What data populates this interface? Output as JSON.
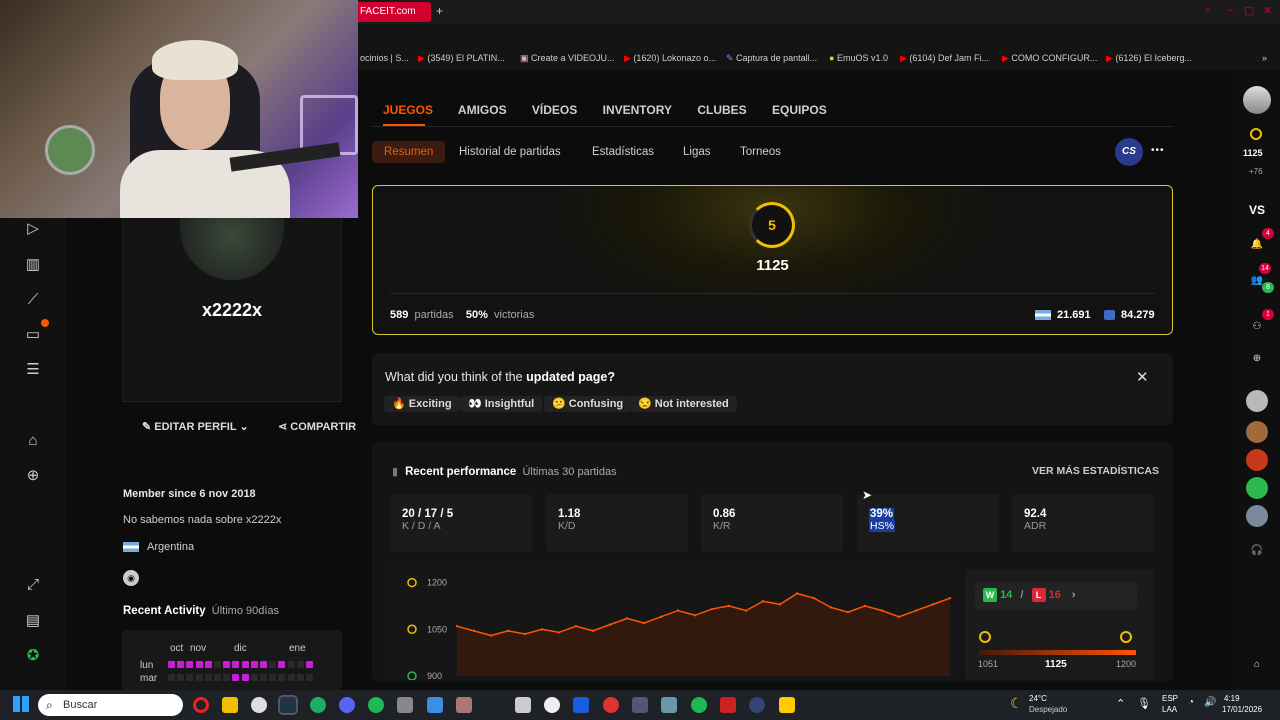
{
  "browser": {
    "active_tab_title": "FACEIT.com",
    "new_tab": "+",
    "extensions_ai_label": "AI"
  },
  "bookmarks": [
    "ocinios | S...",
    "(3549) El PLATIN...",
    "Create a VIDEOJU...",
    "(1620) Lokonazo o...",
    "Captura de pantall...",
    "EmuOS v1.0",
    "(6104) Def Jam Fi...",
    "COMO CONFIGUR...",
    "(6126) El Iceberg..."
  ],
  "profile": {
    "username": "x2222x",
    "edit_label": "EDITAR PERFIL",
    "share_label": "COMPARTIR",
    "member_since": "Member since 6 nov 2018",
    "about": "No sabemos nada sobre x2222x",
    "country": "Argentina",
    "recent_activity_title": "Recent Activity",
    "recent_activity_period": "Último 90días",
    "months": [
      "oct",
      "nov",
      "dic",
      "ene"
    ],
    "days": [
      "lun",
      "mar"
    ]
  },
  "main_tabs": [
    "JUEGOS",
    "AMIGOS",
    "VÍDEOS",
    "INVENTORY",
    "CLUBES",
    "EQUIPOS"
  ],
  "sub_tabs": [
    "Resumen",
    "Historial de partidas",
    "Estadísticas",
    "Ligas",
    "Torneos"
  ],
  "game_badge": "CS",
  "more_label": "•••",
  "rank": {
    "level": "5",
    "elo": "1125",
    "matches_value": "589",
    "matches_label": "partidas",
    "winrate_value": "50%",
    "winrate_label": "victorias",
    "country_rank": "21.691",
    "region_rank": "84.279"
  },
  "survey": {
    "question_prefix": "What did you think of the ",
    "question_bold": "updated page?",
    "options": [
      "🔥 Exciting",
      "👀 Insightful",
      "😕 Confusing",
      "😒 Not interested"
    ]
  },
  "performance": {
    "title": "Recent performance",
    "subtitle": "Últimas 30 partidas",
    "more_stats": "VER MÁS ESTADÍSTICAS",
    "stats": [
      {
        "value": "20 / 17 / 5",
        "label": "K / D / A"
      },
      {
        "value": "1.18",
        "label": "K/D"
      },
      {
        "value": "0.86",
        "label": "K/R"
      },
      {
        "value": "39%",
        "label": "HS%"
      },
      {
        "value": "92.4",
        "label": "ADR"
      }
    ],
    "y_ticks": [
      "1200",
      "1050",
      "900"
    ],
    "wins": "14",
    "losses": "16",
    "win_letter": "W",
    "loss_letter": "L",
    "separator": "/",
    "elo_min": "1051",
    "elo_current": "1125",
    "elo_max": "1200"
  },
  "chart_data": {
    "type": "line",
    "title": "",
    "xlabel": "",
    "ylabel": "",
    "ylim": [
      900,
      1250
    ],
    "x": [
      1,
      2,
      3,
      4,
      5,
      6,
      7,
      8,
      9,
      10,
      11,
      12,
      13,
      14,
      15,
      16,
      17,
      18,
      19,
      20,
      21,
      22,
      23,
      24,
      25,
      26,
      27,
      28,
      29,
      30
    ],
    "series": [
      {
        "values": [
          1060,
          1045,
          1030,
          1045,
          1035,
          1050,
          1040,
          1060,
          1045,
          1065,
          1085,
          1070,
          1090,
          1110,
          1095,
          1115,
          1125,
          1110,
          1140,
          1130,
          1165,
          1150,
          1120,
          1105,
          1125,
          1110,
          1090,
          1110,
          1130,
          1150
        ]
      }
    ]
  },
  "right_sidebar": {
    "elo": "1125",
    "elo_delta": "+76",
    "vs": "VS",
    "notif_badges": [
      "4",
      "14",
      "8",
      "1"
    ]
  },
  "taskbar": {
    "search_placeholder": "Buscar",
    "temperature": "24°C",
    "weather": "Despejado",
    "lang": "ESP",
    "lang2": "LAA",
    "time": "4:19",
    "date": "17/01/2026"
  },
  "colors": {
    "accent": "#ff5500",
    "gold": "#f0c000",
    "win": "#2db84d",
    "loss": "#d8283a"
  }
}
